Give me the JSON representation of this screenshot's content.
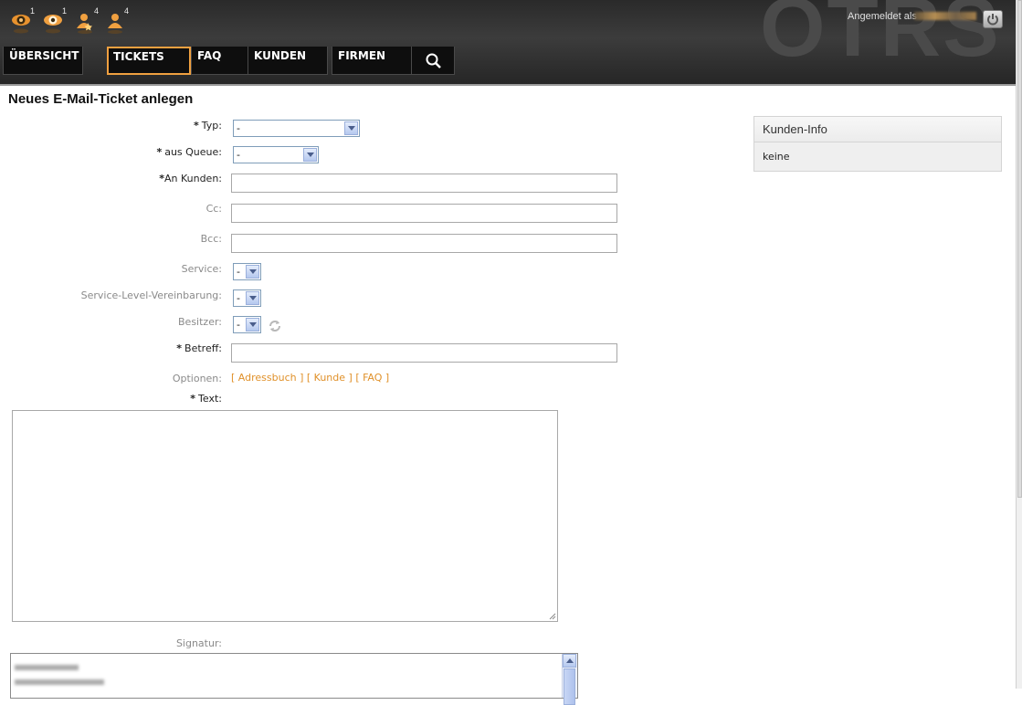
{
  "toolbar": {
    "icons": [
      {
        "name": "locked-watched-icon",
        "count": "1"
      },
      {
        "name": "watched-icon",
        "count": "1"
      },
      {
        "name": "responsible-icon",
        "count": "4"
      },
      {
        "name": "owner-icon",
        "count": "4"
      }
    ],
    "watermark": "OTRS",
    "login_label": "Angemeldet als",
    "logout_icon": "power-icon"
  },
  "nav": {
    "items": [
      "ÜBERSICHT",
      "TICKETS",
      "FAQ",
      "KUNDEN",
      "FIRMEN"
    ],
    "active": "TICKETS",
    "search_icon": "magnifier-icon"
  },
  "page": {
    "title": "Neues E-Mail-Ticket anlegen"
  },
  "form": {
    "required_marker": "*",
    "type_label": "Typ:",
    "type_value": "-",
    "queue_label": "aus Queue:",
    "queue_value": "-",
    "to_label": "An Kunden:",
    "cc_label": "Cc:",
    "bcc_label": "Bcc:",
    "service_label": "Service:",
    "service_value": "-",
    "sla_label": "Service-Level-Vereinbarung:",
    "sla_value": "-",
    "owner_label": "Besitzer:",
    "owner_value": "-",
    "subject_label": "Betreff:",
    "options_label": "Optionen:",
    "options_links": [
      "[ Adressbuch ]",
      "[ Kunde ]",
      "[ FAQ ]"
    ],
    "text_label": "Text:",
    "signature_label": "Signatur:"
  },
  "sidebar": {
    "customer_info_title": "Kunden-Info",
    "customer_info_value": "keine"
  },
  "colors": {
    "accent": "#f0a040",
    "link": "#e0912a",
    "header_bg": "#2f2f2f"
  }
}
